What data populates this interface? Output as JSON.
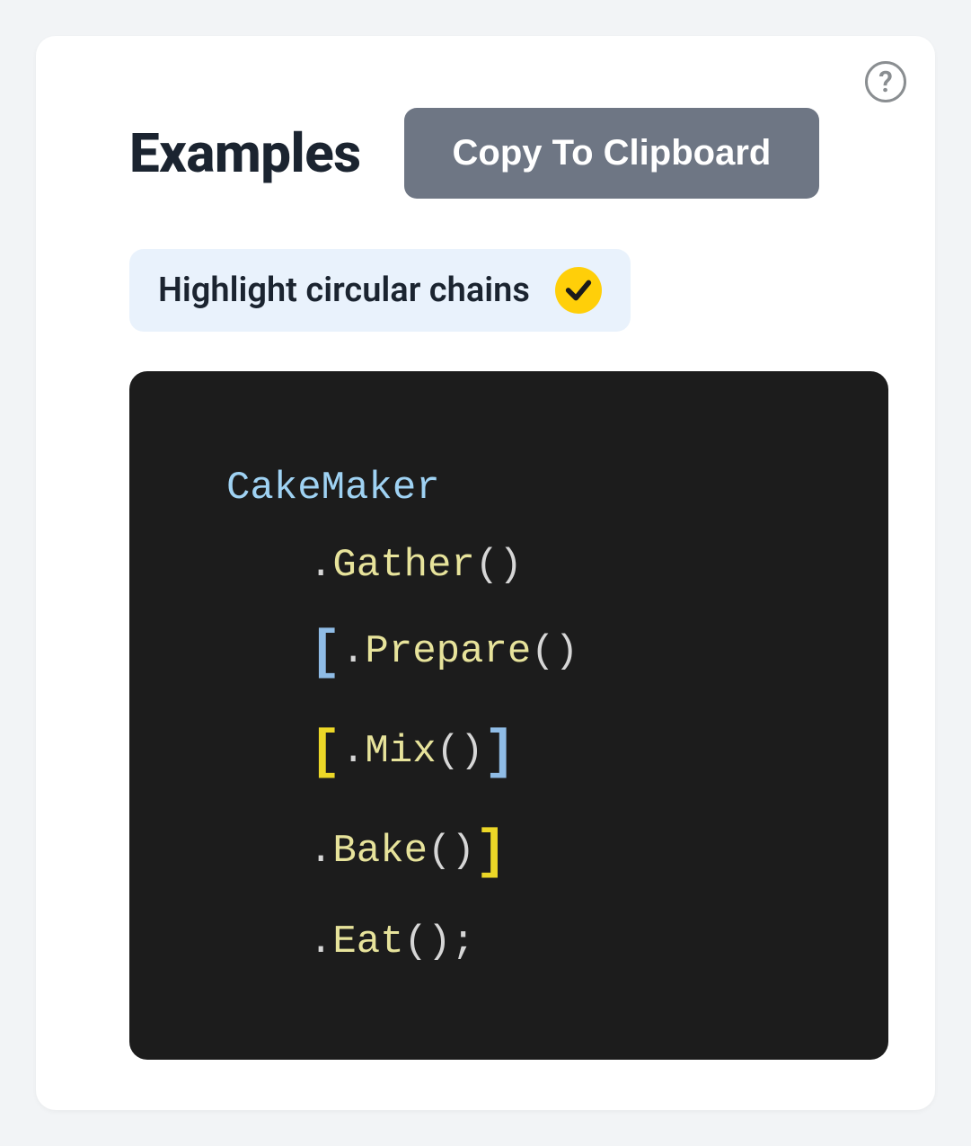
{
  "header": {
    "title": "Examples",
    "copy_button": "Copy To Clipboard"
  },
  "toggle": {
    "label": "Highlight circular chains",
    "checked": true
  },
  "code": {
    "type_name": "CakeMaker",
    "lines": [
      {
        "method": "Gather",
        "open_bracket": null,
        "close_bracket": null,
        "terminator": ""
      },
      {
        "method": "Prepare",
        "open_bracket": "blue",
        "close_bracket": null,
        "terminator": ""
      },
      {
        "method": "Mix",
        "open_bracket": "yellow",
        "close_bracket": "blue",
        "terminator": ""
      },
      {
        "method": "Bake",
        "open_bracket": null,
        "close_bracket": "yellow",
        "terminator": ""
      },
      {
        "method": "Eat",
        "open_bracket": null,
        "close_bracket": null,
        "terminator": ";"
      }
    ]
  }
}
